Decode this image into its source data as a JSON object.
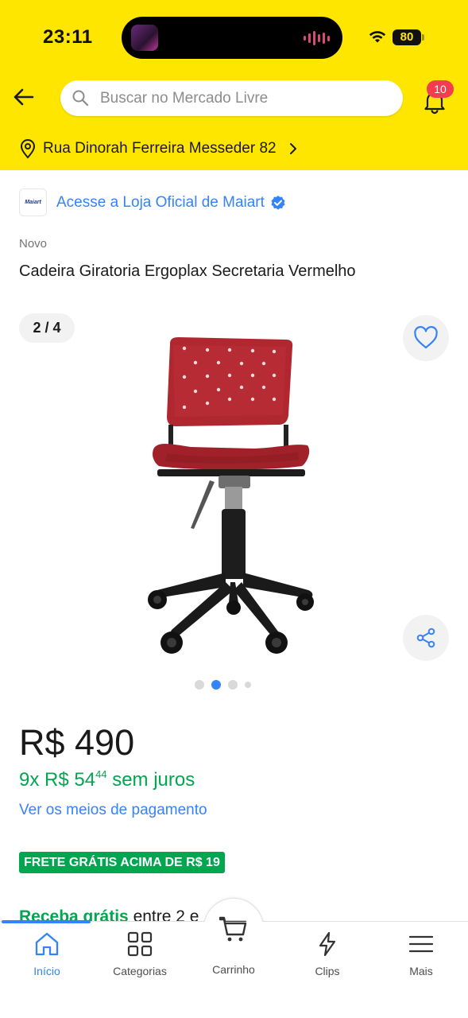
{
  "status_bar": {
    "time": "23:11",
    "battery": "80",
    "battery_level": 0.8
  },
  "header": {
    "search_placeholder": "Buscar no Mercado Livre",
    "notifications_count": "10",
    "location": "Rua Dinorah Ferreira Messeder 82",
    "colors": {
      "background": "#ffe600",
      "badge": "#f23d4f"
    }
  },
  "store": {
    "logo_text": "Maiart",
    "link_label": "Acesse a Loja Oficial de Maiart"
  },
  "product": {
    "condition": "Novo",
    "title": "Cadeira Giratoria Ergoplax Secretaria Vermelho",
    "image_counter": "2 / 4",
    "image_current": 2,
    "image_total": 4
  },
  "pricing": {
    "price": "R$ 490",
    "installments_prefix": "9x R$ 54",
    "installments_cents": "44",
    "installments_suffix": " sem juros",
    "payment_link": "Ver os meios de pagamento",
    "shipping_badge": "FRETE GRÁTIS ACIMA DE R$ 19",
    "delivery_green": "Receba grátis",
    "delivery_rest": " entre 2 e",
    "colors": {
      "green": "#00a650",
      "link": "#3483fa"
    }
  },
  "bottom_nav": {
    "items": [
      {
        "label": "Início",
        "icon": "home-icon",
        "active": true
      },
      {
        "label": "Categorias",
        "icon": "grid-icon",
        "active": false
      },
      {
        "label": "Carrinho",
        "icon": "cart-icon",
        "active": false
      },
      {
        "label": "Clips",
        "icon": "lightning-icon",
        "active": false
      },
      {
        "label": "Mais",
        "icon": "menu-icon",
        "active": false
      }
    ]
  }
}
